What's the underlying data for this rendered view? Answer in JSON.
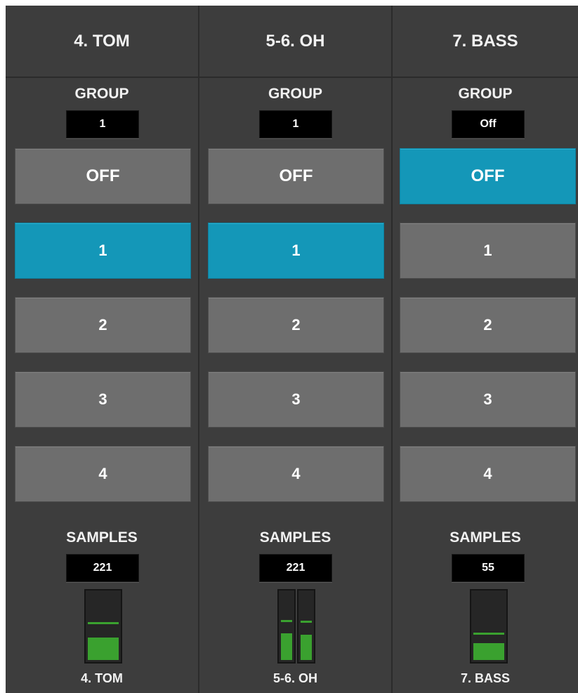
{
  "strips": [
    {
      "name": "4. TOM",
      "group_label": "GROUP",
      "group_value": "1",
      "buttons": [
        "OFF",
        "1",
        "2",
        "3",
        "4"
      ],
      "active_button": "1",
      "samples_label": "SAMPLES",
      "samples_value": "221",
      "meter_levels": [
        0.33
      ],
      "meter_peaks": [
        0.53
      ],
      "footer": "4. TOM"
    },
    {
      "name": "5-6. OH",
      "group_label": "GROUP",
      "group_value": "1",
      "buttons": [
        "OFF",
        "1",
        "2",
        "3",
        "4"
      ],
      "active_button": "1",
      "samples_label": "SAMPLES",
      "samples_value": "221",
      "meter_levels": [
        0.4,
        0.38
      ],
      "meter_peaks": [
        0.56,
        0.55
      ],
      "footer": "5-6. OH"
    },
    {
      "name": "7. BASS",
      "group_label": "GROUP",
      "group_value": "Off",
      "buttons": [
        "OFF",
        "1",
        "2",
        "3",
        "4"
      ],
      "active_button": "OFF",
      "samples_label": "SAMPLES",
      "samples_value": "55",
      "meter_levels": [
        0.25
      ],
      "meter_peaks": [
        0.37
      ],
      "footer": "7. BASS"
    }
  ],
  "colors": {
    "panel": "#3d3d3d",
    "button": "#6e6e6e",
    "active": "#1497b8",
    "meter_green": "#3aa12f"
  }
}
